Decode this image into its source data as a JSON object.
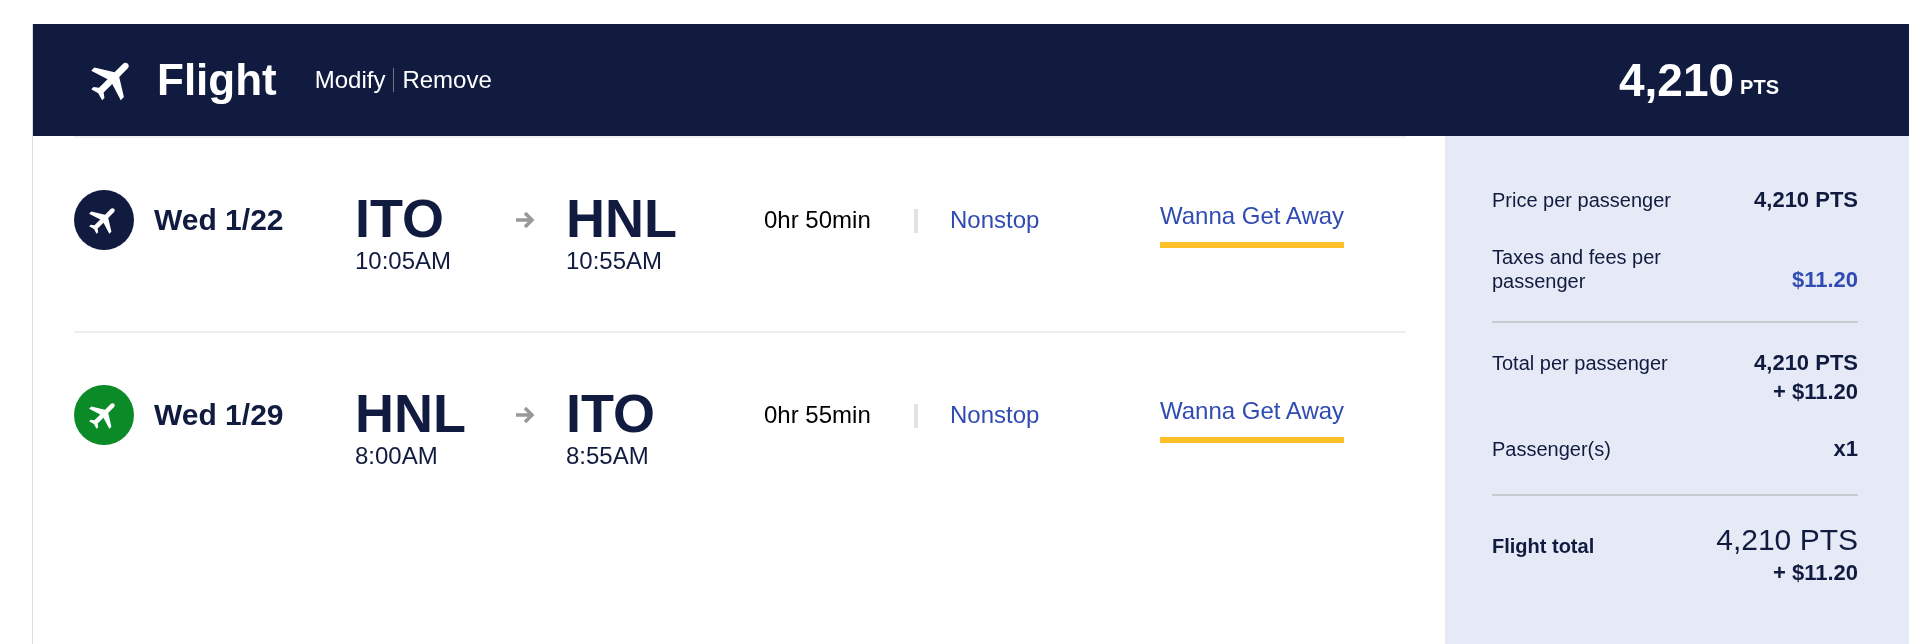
{
  "header": {
    "title": "Flight",
    "actions": [
      "Modify",
      "Remove"
    ],
    "total": {
      "amount": "4,210",
      "unit": "PTS"
    }
  },
  "flights": [
    {
      "color": "#111b40",
      "date": "Wed 1/22",
      "origin": {
        "code": "ITO",
        "time": "10:05AM"
      },
      "destination": {
        "code": "HNL",
        "time": "10:55AM"
      },
      "duration": "0hr 50min",
      "stops": "Nonstop",
      "fare": "Wanna Get Away"
    },
    {
      "color": "#0b8a28",
      "date": "Wed 1/29",
      "origin": {
        "code": "HNL",
        "time": "8:00AM"
      },
      "destination": {
        "code": "ITO",
        "time": "8:55AM"
      },
      "duration": "0hr 55min",
      "stops": "Nonstop",
      "fare": "Wanna Get Away"
    }
  ],
  "summary": {
    "groups": [
      [
        {
          "kind": "standard",
          "label": "Price per passenger",
          "values": [
            "4,210 PTS"
          ]
        },
        {
          "kind": "fee",
          "label": "Taxes and fees per passenger",
          "values": [
            "$11.20"
          ]
        }
      ],
      [
        {
          "kind": "standard",
          "label": "Total per passenger",
          "values": [
            "4,210 PTS",
            "+ $11.20"
          ]
        },
        {
          "kind": "standard",
          "label": "Passenger(s)",
          "values": [
            "x1"
          ]
        }
      ],
      [
        {
          "kind": "grand",
          "label": "Flight total",
          "values": [
            "4,210 PTS",
            "+ $11.20"
          ]
        }
      ]
    ]
  }
}
